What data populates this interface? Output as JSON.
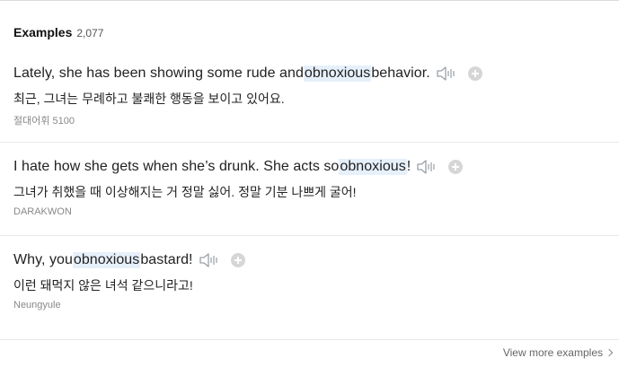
{
  "header": {
    "title": "Examples",
    "count": "2,077"
  },
  "examples": [
    {
      "en_before": "Lately, she has been showing some rude and ",
      "en_highlight": "obnoxious",
      "en_after": " behavior.",
      "ko": "최근, 그녀는 무례하고 불쾌한 행동을 보이고 있어요.",
      "source": "절대어휘 5100"
    },
    {
      "en_before": "I hate how she gets when she’s drunk. She acts so ",
      "en_highlight": "obnoxious",
      "en_after": "!",
      "ko": "그녀가 취했을 때 이상해지는 거 정말 싫어. 정말 기분 나쁘게 굴어!",
      "source": "DARAKWON"
    },
    {
      "en_before": "Why, you ",
      "en_highlight": "obnoxious",
      "en_after": " bastard!",
      "ko": "이런 돼먹지 않은 녀석 같으니라고!",
      "source": "Neungyule"
    }
  ],
  "footer": {
    "view_more": "View more examples"
  },
  "icons": {
    "audio": "speaker-icon",
    "add": "plus-icon",
    "more": "chevron-right-icon"
  },
  "colors": {
    "highlight_bg": "#e6f0fb",
    "icon_gray": "#9aa0a6"
  }
}
